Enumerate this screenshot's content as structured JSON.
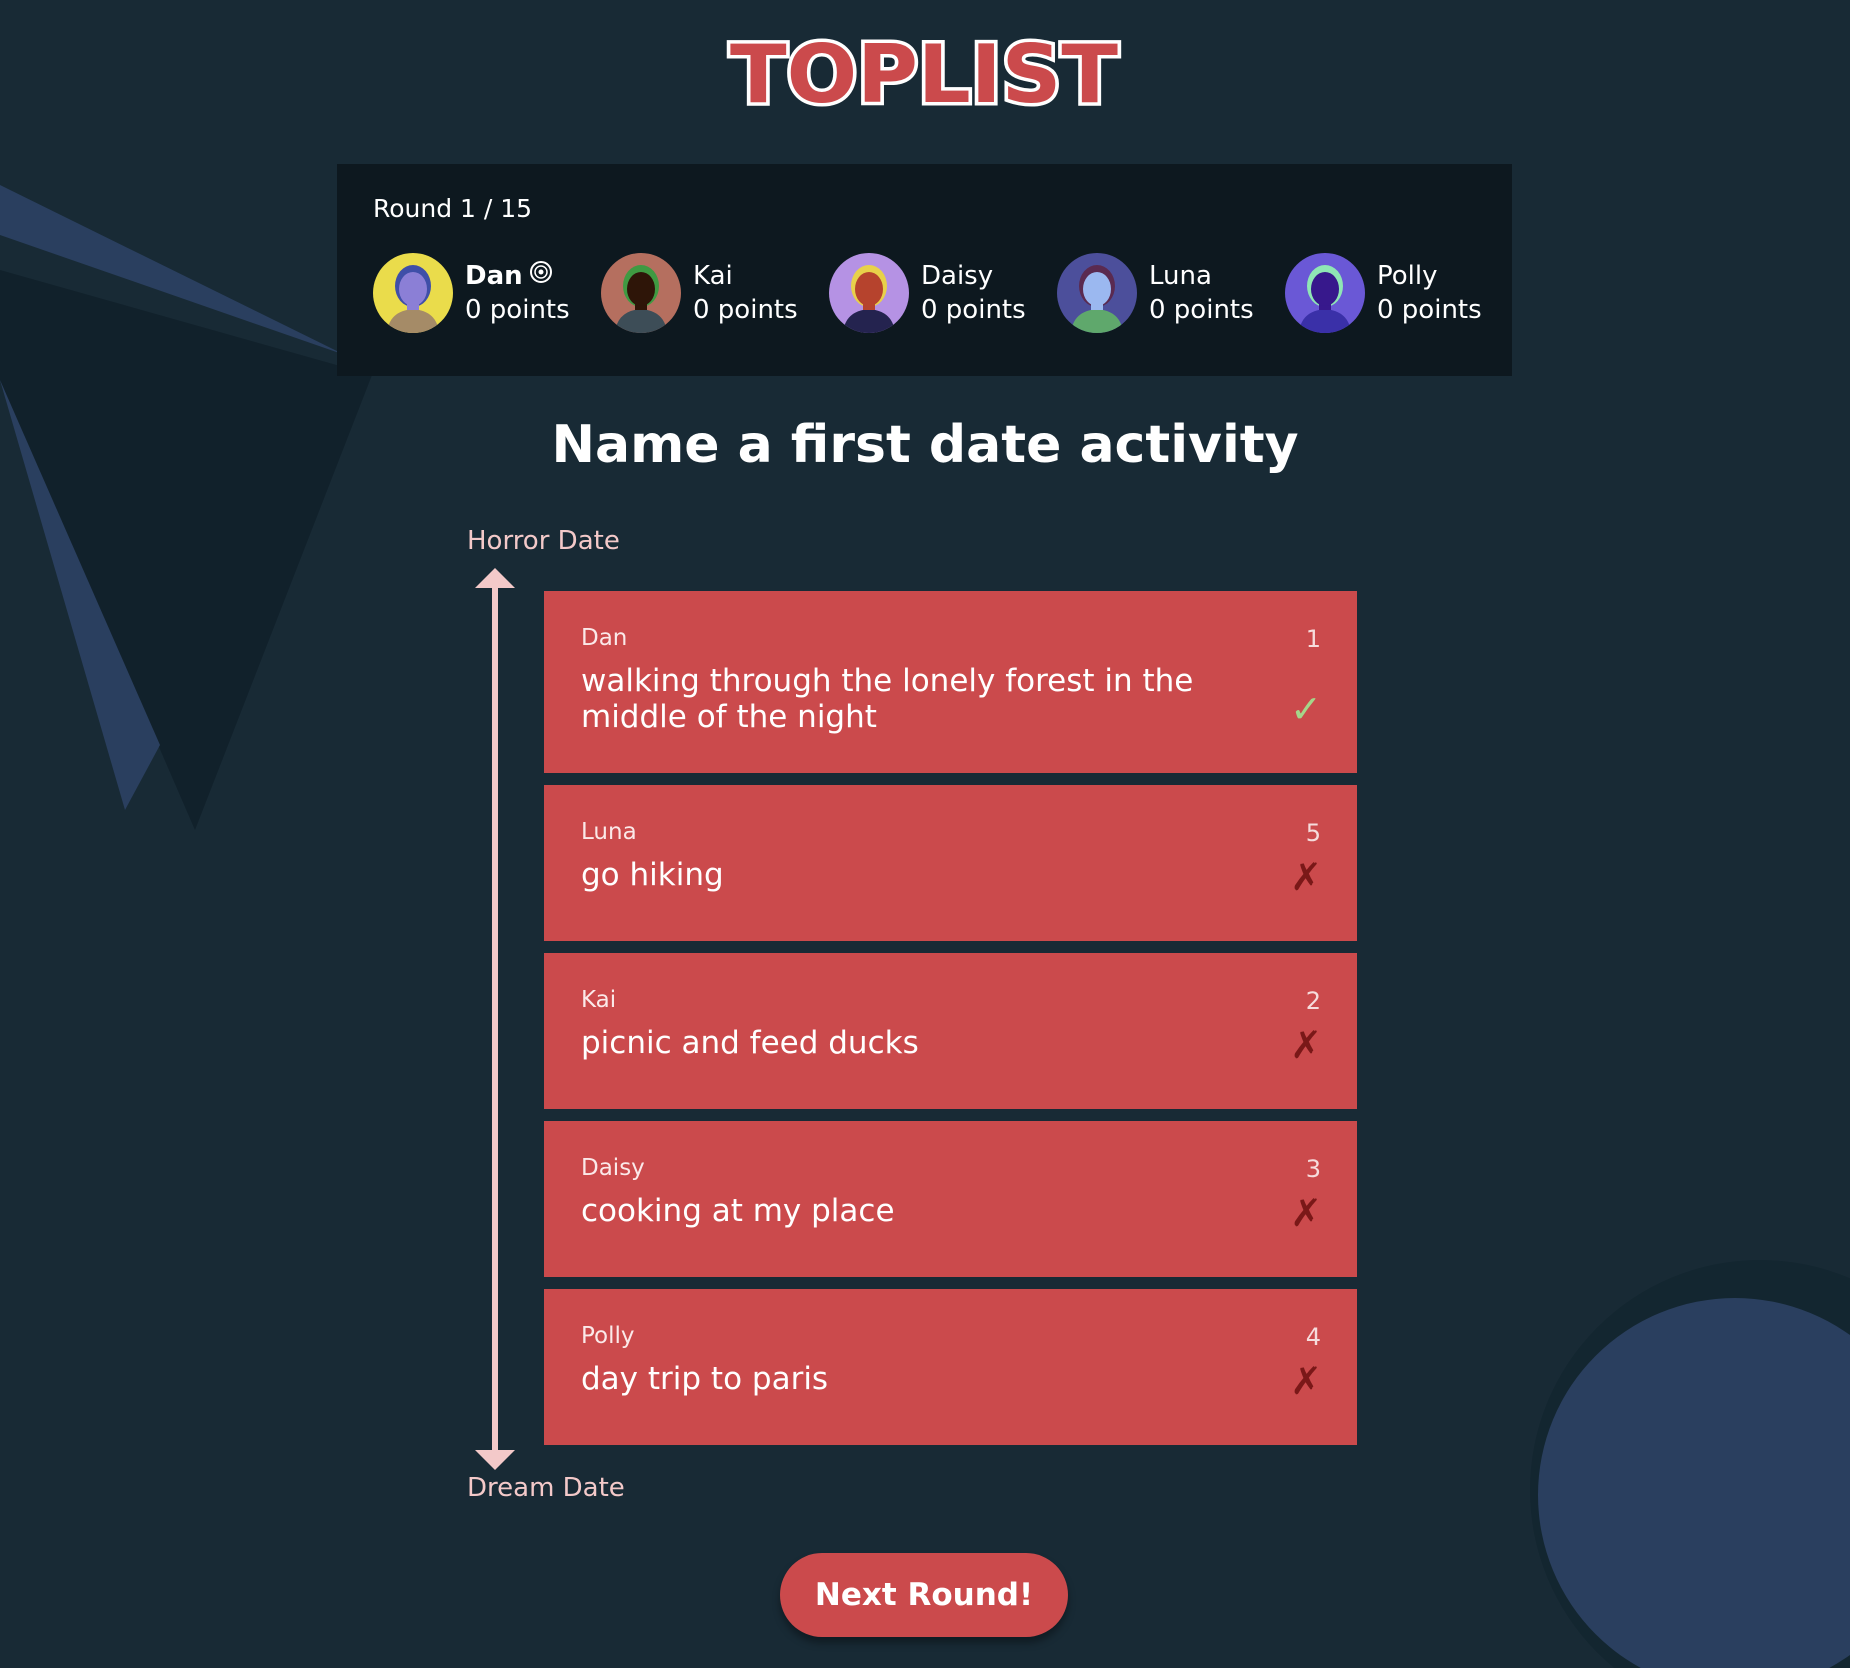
{
  "logo_text": "TOPLIST",
  "round_label": "Round 1 / 15",
  "players": [
    {
      "name": "Dan",
      "points": "0 points",
      "host": true,
      "avatar_bg": "#eadc4b",
      "hair": "#3f4fa8",
      "skin": "#8b7fd6",
      "shirt": "#a58b67"
    },
    {
      "name": "Kai",
      "points": "0 points",
      "host": false,
      "avatar_bg": "#b56f5f",
      "hair": "#3f9a42",
      "skin": "#2e1508",
      "shirt": "#3d4d57"
    },
    {
      "name": "Daisy",
      "points": "0 points",
      "host": false,
      "avatar_bg": "#b592e4",
      "hair": "#e8d14a",
      "skin": "#b6432d",
      "shirt": "#24234f"
    },
    {
      "name": "Luna",
      "points": "0 points",
      "host": false,
      "avatar_bg": "#4c4f9b",
      "hair": "#5a2a50",
      "skin": "#9bb8f0",
      "shirt": "#5fa86c"
    },
    {
      "name": "Polly",
      "points": "0 points",
      "host": false,
      "avatar_bg": "#6a58d6",
      "hair": "#8fe6b5",
      "skin": "#37188c",
      "shirt": "#3a30a8"
    }
  ],
  "question": "Name a first date activity",
  "scale": {
    "top": "Horror Date",
    "bottom": "Dream Date"
  },
  "answers": [
    {
      "author": "Dan",
      "text": "walking through the lonely forest in the middle of the night",
      "rank": "1",
      "mark": "✓",
      "correct": true
    },
    {
      "author": "Luna",
      "text": "go hiking",
      "rank": "5",
      "mark": "✗",
      "correct": false
    },
    {
      "author": "Kai",
      "text": "picnic and feed ducks",
      "rank": "2",
      "mark": "✗",
      "correct": false
    },
    {
      "author": "Daisy",
      "text": "cooking at my place",
      "rank": "3",
      "mark": "✗",
      "correct": false
    },
    {
      "author": "Polly",
      "text": "day trip to paris",
      "rank": "4",
      "mark": "✗",
      "correct": false
    }
  ],
  "next_button": "Next Round!",
  "colors": {
    "background": "#182a35",
    "panel": "#0d181f",
    "card": "#cb4a4c",
    "accent_light": "#f3c9c9",
    "correct": "#a5d68a",
    "wrong": "#7a1818"
  }
}
